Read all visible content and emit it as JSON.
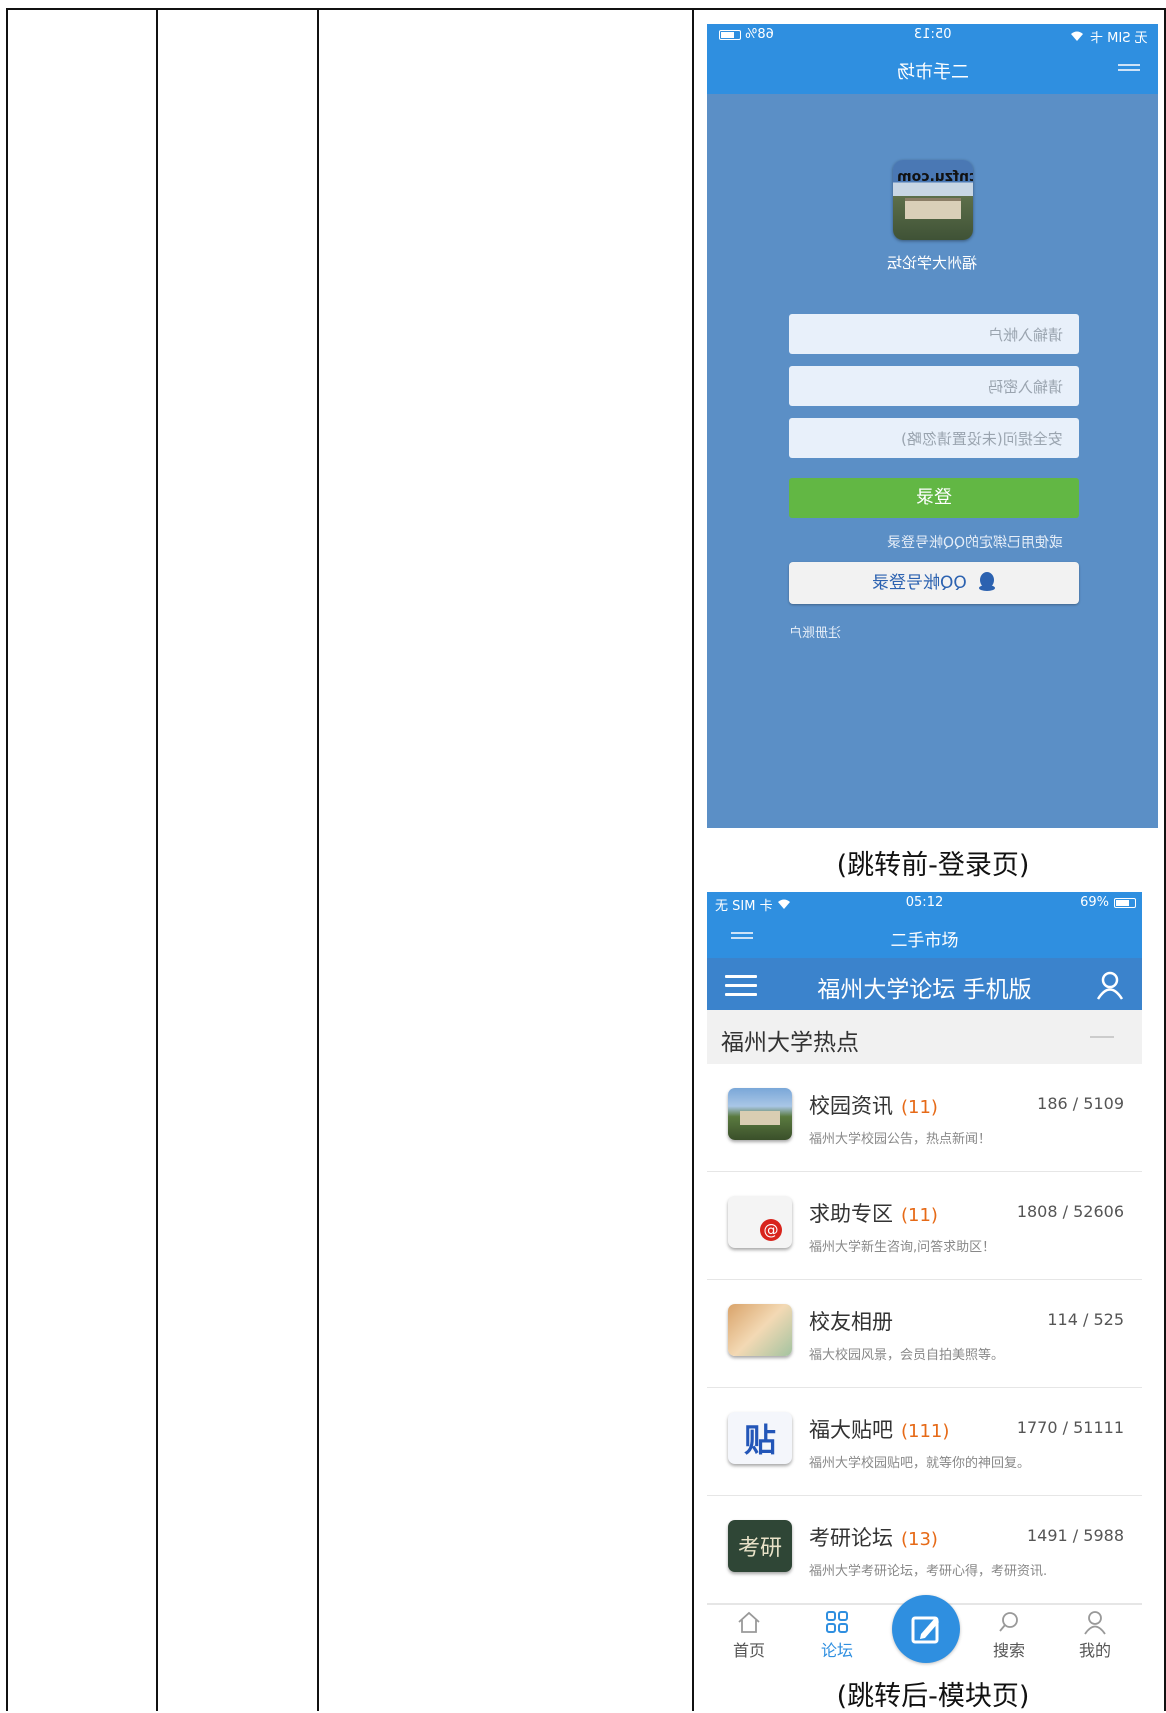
{
  "login_screen": {
    "status": {
      "carrier": "无 SIM 卡",
      "time": "05:13",
      "battery": "68%"
    },
    "header_title": "二手市场",
    "app_name": "福州大学论坛",
    "logo_text": "福大 cnfzu.com",
    "username_placeholder": "请输入帐户",
    "password_placeholder": "请输入密码",
    "security_placeholder": "安全提问(未设置请忽略)",
    "login_button": "登录",
    "qq_hint": "或使用已绑定的QQ帐号登录",
    "qq_button": "QQ帐号登录",
    "register_link": "注册账户"
  },
  "caption_before": "(跳转前-登录页)",
  "forum_screen": {
    "status": {
      "carrier": "无 SIM 卡",
      "time": "05:12",
      "battery": "69%"
    },
    "sub_title": "二手市场",
    "nav_title": "福州大学论坛 手机版",
    "section_title": "福州大学热点",
    "forums": [
      {
        "name": "校园资讯",
        "count": "(11)",
        "stats": "186 / 5109",
        "desc": "福州大学校园公告，热点新闻！"
      },
      {
        "name": "求助专区",
        "count": "(11)",
        "stats": "1808 / 52606",
        "desc": "福州大学新生咨询,问答求助区！"
      },
      {
        "name": "校友相册",
        "count": "",
        "stats": "114 / 525",
        "desc": "福大校园风景，会员自拍美照等。"
      },
      {
        "name": "福大贴吧",
        "count": "(111)",
        "stats": "1770 / 51111",
        "desc": "福州大学校园贴吧，就等你的神回复。"
      },
      {
        "name": "考研论坛",
        "count": "(13)",
        "stats": "1491 / 5988",
        "desc": "福州大学考研论坛，考研心得，考研资讯."
      }
    ],
    "icon_glyphs": {
      "help": "@",
      "tieba": "贴",
      "kaoyan": "考研"
    },
    "tabs": {
      "home": "首页",
      "forum": "论坛",
      "search": "搜索",
      "me": "我的"
    }
  },
  "caption_after": "(跳转后-模块页)",
  "colors": {
    "accent": "#2f8fe0",
    "login_bg": "#5b8fc6",
    "login_button": "#62b744",
    "count_orange": "#e66a17"
  }
}
